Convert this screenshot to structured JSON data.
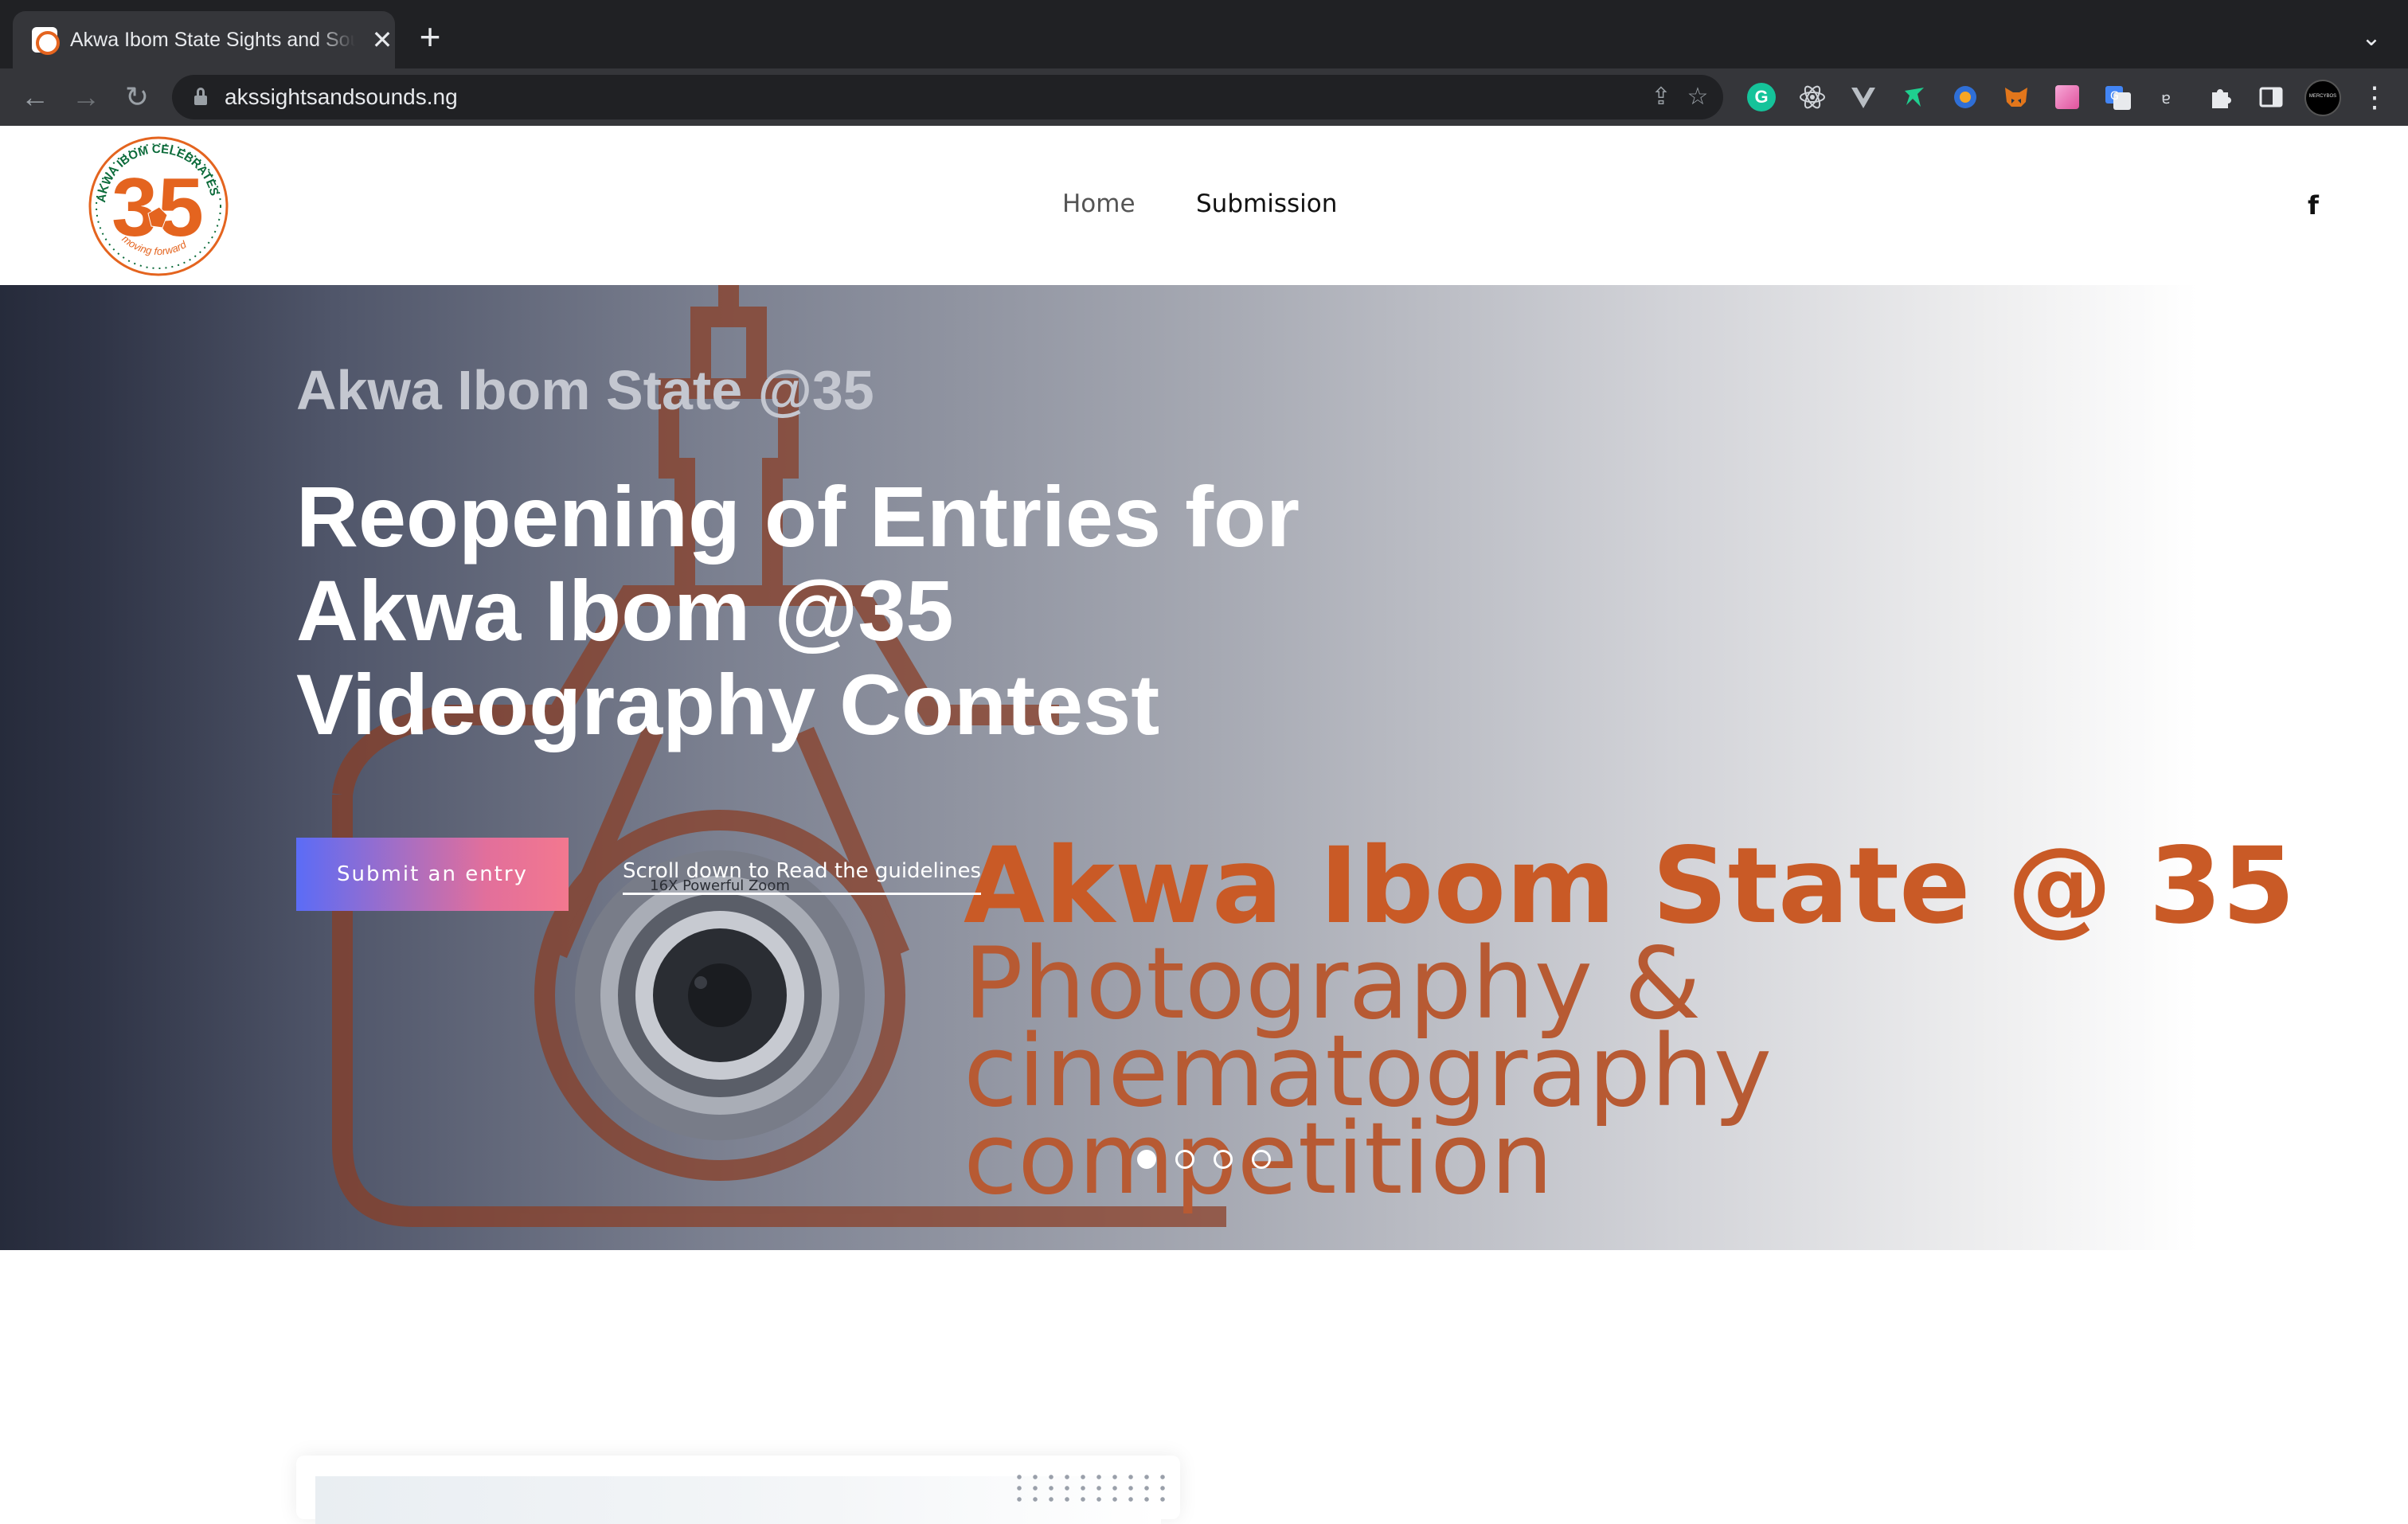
{
  "browser": {
    "tab_title": "Akwa Ibom State Sights and Sounds",
    "url": "akssightsandsounds.ng",
    "tab_close_symbol": "✕",
    "new_tab_symbol": "+",
    "tab_search_symbol": "⌄",
    "back_symbol": "←",
    "forward_symbol": "→",
    "reload_symbol": "↻",
    "share_symbol": "⇪",
    "bookmark_symbol": "☆",
    "menu_symbol": "⋮",
    "extension_grammarly_letter": "G"
  },
  "header": {
    "logo_text": {
      "top": "AKWA IBOM CELEBRATES",
      "number": "35",
      "bottom": "moving forward"
    },
    "nav": [
      {
        "label": "Home"
      },
      {
        "label": "Submission"
      }
    ],
    "facebook_symbol": "f"
  },
  "hero": {
    "eyebrow": "Akwa Ibom State @35",
    "title_lines": [
      "Reopening of Entries for",
      "Akwa Ibom @35",
      "Videography Contest"
    ],
    "primary_cta": "Submit an entry",
    "secondary_cta": "Scroll down to Read the guidelines",
    "banner": {
      "heading": "Akwa Ibom State @ 35",
      "line1": "Photography &",
      "line2": "cinematography",
      "line3": "competition",
      "lens_text": "16X Powerful Zoom"
    },
    "slides_total": 4,
    "active_slide": 1
  },
  "colors": {
    "brand_orange": "#e4641f",
    "brand_green": "#0b6b3a",
    "cta_gradient_start": "#5b6cf6",
    "cta_gradient_end": "#f3788f"
  },
  "icons": {
    "lock": "lock-icon",
    "facebook": "facebook-icon",
    "extensions": [
      "grammarly-icon",
      "react-devtools-icon",
      "vue-devtools-icon",
      "ext-green-icon",
      "ext-blue-icon",
      "metamask-icon",
      "ext-gradient-icon",
      "google-translate-icon",
      "ext-small-icon",
      "puzzle-icon",
      "sidebar-icon",
      "profile-avatar"
    ]
  }
}
